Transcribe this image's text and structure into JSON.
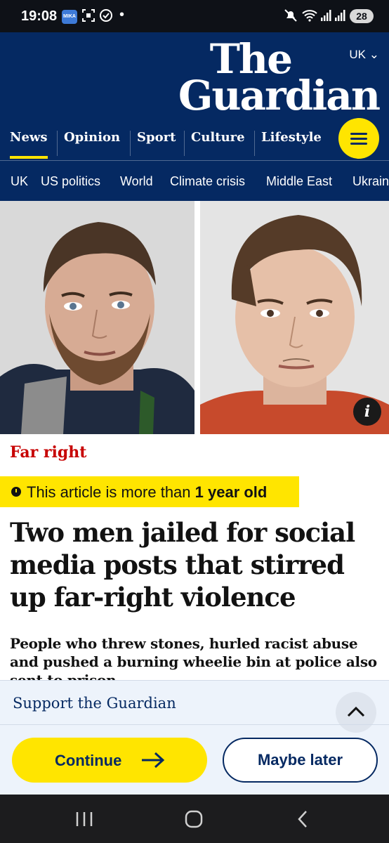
{
  "status_bar": {
    "time": "19:08",
    "app_badge": "MIKA",
    "battery": "28"
  },
  "header": {
    "edition": "UK ⌄",
    "logo_line1": "The",
    "logo_line2": "Guardian",
    "pillars": [
      {
        "label": "News"
      },
      {
        "label": "Opinion"
      },
      {
        "label": "Sport"
      },
      {
        "label": "Culture"
      },
      {
        "label": "Lifestyle"
      }
    ],
    "subnav": [
      {
        "label": "UK"
      },
      {
        "label": "US politics"
      },
      {
        "label": "World"
      },
      {
        "label": "Climate crisis"
      },
      {
        "label": "Middle East"
      },
      {
        "label": "Ukraine"
      }
    ]
  },
  "article": {
    "info_icon": "i",
    "kicker": "Far right",
    "age_notice_prefix": "This article is more than ",
    "age_notice_bold": "1 year old",
    "headline": "Two men jailed for social media posts that stirred up far-right violence",
    "standfirst": "People who threw stones, hurled racist abuse and pushed a burning wheelie bin at police also sent to prison"
  },
  "support_banner": {
    "title": "Support the Guardian",
    "continue_label": "Continue",
    "maybe_later_label": "Maybe later"
  },
  "colors": {
    "brand_blue": "#052962",
    "accent_yellow": "#ffe500",
    "kicker_red": "#c70000"
  }
}
